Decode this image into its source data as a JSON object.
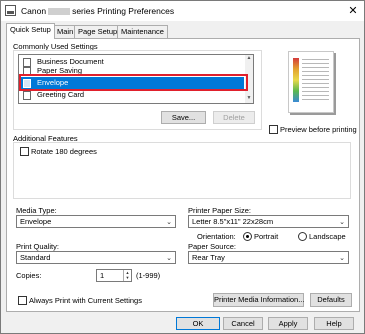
{
  "window": {
    "title_prefix": "Canon",
    "title_suffix": "series Printing Preferences",
    "close_label": "✕"
  },
  "tabs": [
    "Quick Setup",
    "Main",
    "Page Setup",
    "Maintenance"
  ],
  "common": {
    "label": "Commonly Used Settings",
    "items": [
      "Business Document",
      "Paper Saving",
      "Envelope",
      "Greeting Card"
    ],
    "selected_index": 2,
    "save_label": "Save...",
    "delete_label": "Delete"
  },
  "preview": {
    "checkbox_label": "Preview before printing"
  },
  "additional": {
    "label": "Additional Features",
    "rotate_label": "Rotate 180 degrees"
  },
  "media": {
    "label": "Media Type:",
    "value": "Envelope"
  },
  "paper_size": {
    "label": "Printer Paper Size:",
    "value": "Letter 8.5\"x11\" 22x28cm",
    "orientation_label": "Orientation:",
    "portrait": "Portrait",
    "landscape": "Landscape"
  },
  "quality": {
    "label": "Print Quality:",
    "value": "Standard"
  },
  "source": {
    "label": "Paper Source:",
    "value": "Rear Tray"
  },
  "copies": {
    "label": "Copies:",
    "value": "1",
    "range": "(1-999)"
  },
  "always_print_label": "Always Print with Current Settings",
  "media_info_label": "Printer Media Information...",
  "defaults_label": "Defaults",
  "footer": {
    "ok": "OK",
    "cancel": "Cancel",
    "apply": "Apply",
    "help": "Help"
  },
  "colors": {
    "selection": "#0078d7",
    "highlight_frame": "#e0202c"
  }
}
